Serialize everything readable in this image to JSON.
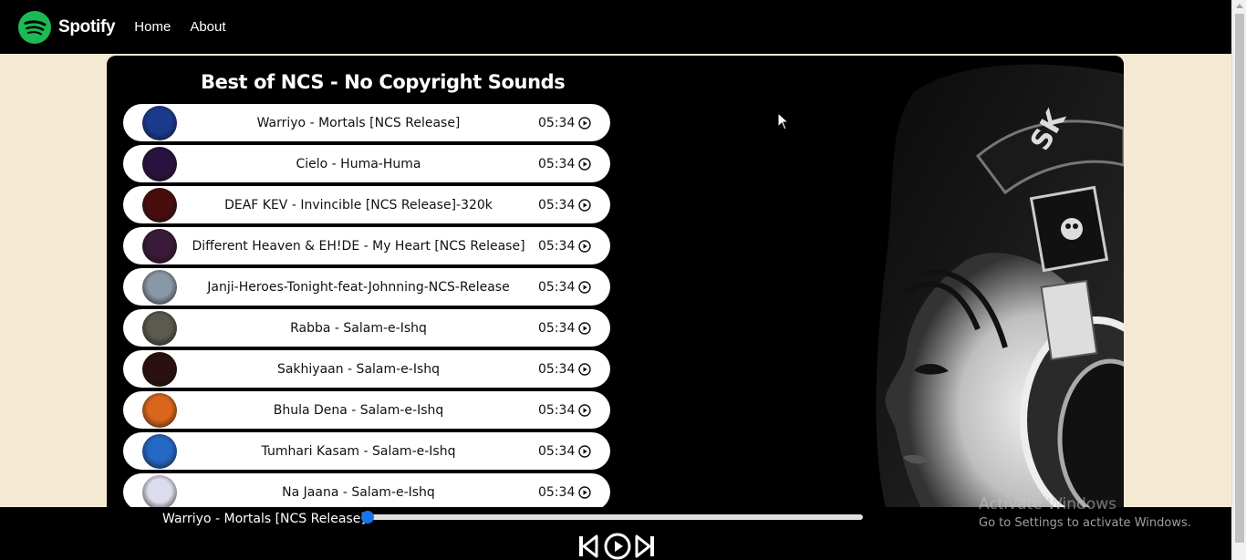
{
  "navbar": {
    "brand": "Spotify",
    "links": [
      "Home",
      "About"
    ],
    "brand_color": "#1db954"
  },
  "playlist": {
    "title": "Best of NCS - No Copyright Sounds",
    "songs": [
      {
        "name": "Warriyo - Mortals [NCS Release]",
        "duration": "05:34",
        "cover_color": "#1b3a8c"
      },
      {
        "name": "Cielo - Huma-Huma",
        "duration": "05:34",
        "cover_color": "#2a1240"
      },
      {
        "name": "DEAF KEV - Invincible [NCS Release]-320k",
        "duration": "05:34",
        "cover_color": "#4a0d0d"
      },
      {
        "name": "Different Heaven & EH!DE - My Heart [NCS Release]",
        "duration": "05:34",
        "cover_color": "#3a1a3a"
      },
      {
        "name": "Janji-Heroes-Tonight-feat-Johnning-NCS-Release",
        "duration": "05:34",
        "cover_color": "#8a98a6"
      },
      {
        "name": "Rabba - Salam-e-Ishq",
        "duration": "05:34",
        "cover_color": "#5a5a4e"
      },
      {
        "name": "Sakhiyaan - Salam-e-Ishq",
        "duration": "05:34",
        "cover_color": "#2a1010"
      },
      {
        "name": "Bhula Dena - Salam-e-Ishq",
        "duration": "05:34",
        "cover_color": "#d9661c"
      },
      {
        "name": "Tumhari Kasam - Salam-e-Ishq",
        "duration": "05:34",
        "cover_color": "#2467c4"
      },
      {
        "name": "Na Jaana - Salam-e-Ishq",
        "duration": "05:34",
        "cover_color": "#dcdcec"
      }
    ]
  },
  "player": {
    "current_song": "Warriyo - Mortals [NCS Release]",
    "progress": 0.0
  },
  "watermark": {
    "title": "Activate Windows",
    "subtitle": "Go to Settings to activate Windows."
  },
  "colors": {
    "background": "#f4ead4",
    "panel": "#000000",
    "accent": "#1a73e8"
  }
}
